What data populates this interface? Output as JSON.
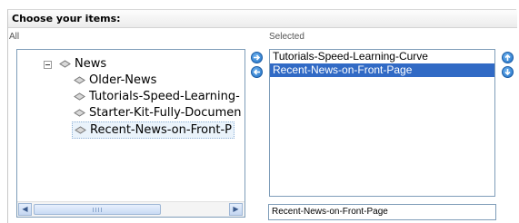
{
  "panel": {
    "title": "Choose your items:"
  },
  "available": {
    "label": "All",
    "tree": {
      "root": "News",
      "children": [
        "Older-News",
        "Tutorials-Speed-Learning-",
        "Starter-Kit-Fully-Documen",
        "Recent-News-on-Front-P"
      ],
      "selected_child": "Recent-News-on-Front-P"
    },
    "scrollbar_position": 0.05
  },
  "selected": {
    "label": "Selected",
    "items": [
      "Tutorials-Speed-Learning-Curve",
      "Recent-News-on-Front-Page"
    ],
    "highlighted": "Recent-News-on-Front-Page",
    "current_value": "Recent-News-on-Front-Page"
  },
  "icons": {
    "add": "arrow-right-icon",
    "remove": "arrow-left-icon",
    "move_up": "arrow-up-icon",
    "move_down": "arrow-down-icon",
    "expander": "collapse-icon",
    "item": "diamond-item-icon"
  },
  "colors": {
    "accent": "#316ac5",
    "border": "#7f9db9",
    "button": "#1f6fc4"
  }
}
